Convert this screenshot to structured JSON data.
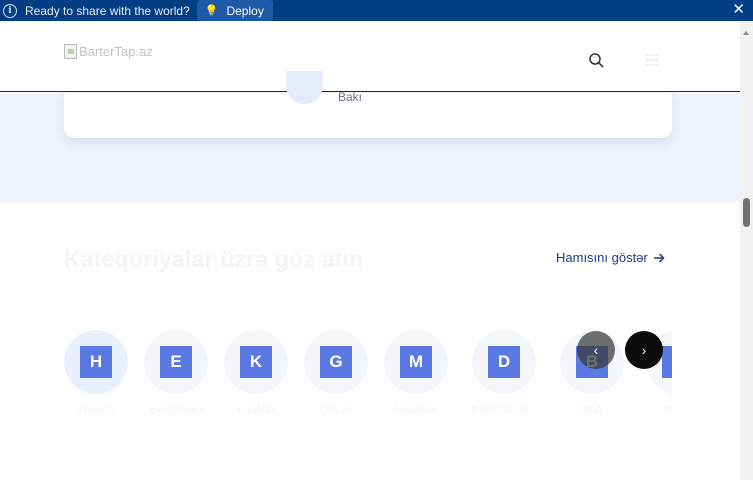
{
  "banner": {
    "message": "Ready to share with the world?",
    "deploy_label": "Deploy",
    "background": "#003d82"
  },
  "header": {
    "logo_alt": "BarterTap.az",
    "search_icon": "search-icon",
    "menu_icon": "menu-icon"
  },
  "hero": {
    "card_city": "Bakı"
  },
  "categories": {
    "title": "Kateqoriyalar üzrə göz atın",
    "show_all_label": "Hamısını göstər",
    "items": [
      {
        "letter": "H",
        "name": "Hamısı"
      },
      {
        "letter": "E",
        "name": "Elektronika"
      },
      {
        "letter": "K",
        "name": "Kitablar"
      },
      {
        "letter": "G",
        "name": "Geyim"
      },
      {
        "letter": "M",
        "name": "Mebellər"
      },
      {
        "letter": "D",
        "name": "Dəmirsəmə..."
      },
      {
        "letter": "B",
        "name": "Bağ"
      },
      {
        "letter": "O",
        "name": "Oyun"
      }
    ],
    "prev_glyph": "‹",
    "next_glyph": "›"
  },
  "colors": {
    "accent": "#5b79e3",
    "link": "#1e3a8a",
    "hero_bg": "#eef3fd"
  }
}
